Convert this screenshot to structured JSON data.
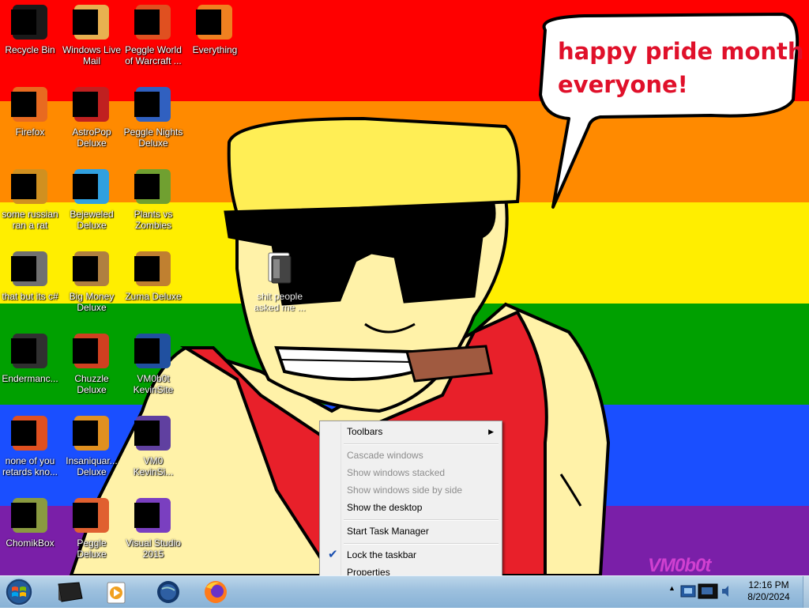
{
  "desktop": {
    "speech_line1": "happy pride month",
    "speech_line2": "everyone!",
    "watermark": "VM0b0t",
    "folder_label": "shit people\nasked me ...",
    "icons": [
      {
        "label": "Recycle Bin",
        "icon": "recycle-bin-icon",
        "color": "#1a1a1a"
      },
      {
        "label": "Windows Live\nMail",
        "icon": "envelope-icon",
        "color": "#e8b050"
      },
      {
        "label": "Peggle World\nof Warcraft ...",
        "icon": "peggle-icon",
        "color": "#e05020"
      },
      {
        "label": "Everything",
        "icon": "magnifier-icon",
        "color": "#f08020"
      },
      {
        "label": "Firefox",
        "icon": "firefox-icon",
        "color": "#e86a20"
      },
      {
        "label": "AstroPop\nDeluxe",
        "icon": "astropop-icon",
        "color": "#c02020"
      },
      {
        "label": "Peggle Nights\nDeluxe",
        "icon": "peggle-nights-icon",
        "color": "#3060c0"
      },
      {
        "label": "some russian\nran a rat",
        "icon": "document-icon",
        "color": "#d09020"
      },
      {
        "label": "Bejeweled\nDeluxe",
        "icon": "gem-icon",
        "color": "#30a0e0"
      },
      {
        "label": "Plants vs\nZombies",
        "icon": "plant-icon",
        "color": "#70a030"
      },
      {
        "label": "that but its c#",
        "icon": "window-stack-icon",
        "color": "#707070"
      },
      {
        "label": "Big Money\nDeluxe",
        "icon": "money-bag-icon",
        "color": "#b08040"
      },
      {
        "label": "Zuma Deluxe",
        "icon": "frog-icon",
        "color": "#c08030"
      },
      {
        "label": "Endermanc...",
        "icon": "terminal-icon",
        "color": "#303030"
      },
      {
        "label": "Chuzzle\nDeluxe",
        "icon": "chuzzle-icon",
        "color": "#d04020"
      },
      {
        "label": "VM0b0t\nKevinSite",
        "icon": "site-icon",
        "color": "#2050a0"
      },
      {
        "label": "none of you\nretards kno...",
        "icon": "orange-circle-icon",
        "color": "#e05020"
      },
      {
        "label": "Insaniquar...\nDeluxe",
        "icon": "fish-icon",
        "color": "#e09020"
      },
      {
        "label": "VM0\nKevinSi...",
        "icon": "purple-file-icon",
        "color": "#6040a0"
      },
      {
        "label": "ChomikBox",
        "icon": "hamster-icon",
        "color": "#8a9a40"
      },
      {
        "label": "Peggle Deluxe",
        "icon": "peggle-deluxe-icon",
        "color": "#e06030"
      },
      {
        "label": "Visual Studio\n2015",
        "icon": "visual-studio-icon",
        "color": "#7a3fc0"
      }
    ]
  },
  "context_menu": {
    "toolbars": "Toolbars",
    "cascade": "Cascade windows",
    "stacked": "Show windows stacked",
    "side_by_side": "Show windows side by side",
    "show_desktop": "Show the desktop",
    "task_manager": "Start Task Manager",
    "lock_taskbar": "Lock the taskbar",
    "properties": "Properties",
    "lock_checked": true
  },
  "taskbar": {
    "pinned": [
      "vm-app-icon",
      "media-player-icon",
      "globe-icon",
      "firefox-icon"
    ],
    "tray_arrow": "▲",
    "clock_time": "12:16 PM",
    "clock_date": "8/20/2024"
  },
  "colors": {
    "red": "#ff0000",
    "orange": "#ff8a00",
    "yellow": "#ffee00",
    "green": "#00a000",
    "blue": "#1a4fff",
    "purple": "#7a1fa8",
    "skin": "#fff2a8",
    "hat": "#ffee55",
    "cigar": "#a05a40"
  }
}
